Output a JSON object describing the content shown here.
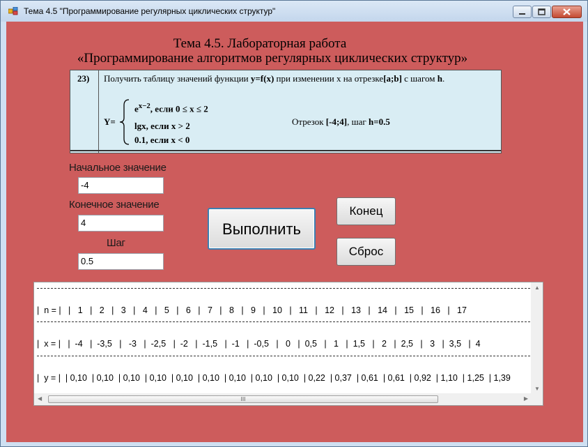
{
  "window": {
    "title": "Тема 4.5 \"Программирование регулярных циклических структур\""
  },
  "heading": {
    "line1": "Тема 4.5.  Лабораторная работа",
    "line2": "«Программирование алгоритмов регулярных циклических структур»"
  },
  "task": {
    "number": "23)",
    "description_part1": "Получить таблицу значений функции ",
    "description_fx": "y=f(x)",
    "description_part2": " при изменении x  на отрезке",
    "description_range": "[a;b]",
    "description_part3": " с шагом ",
    "description_step": "h",
    "description_end": ".",
    "y_label": "Y=",
    "case1_expr": "e",
    "case1_exp": "x−2",
    "case1_cond": ",    если 0 ≤ x ≤ 2",
    "case2": "lgx,     если x > 2",
    "case3": "0.1,      если x < 0",
    "segment_prefix": "Отрезок ",
    "segment_value": "[-4;4]",
    "segment_mid": ",  шаг ",
    "segment_step": "h=0.5"
  },
  "form": {
    "start_label": "Начальное значение",
    "start_value": "-4",
    "end_label": "Конечное значение",
    "end_value": "4",
    "step_label": "Шаг",
    "step_value": "0.5"
  },
  "buttons": {
    "run": "Выполнить",
    "exit": "Конец",
    "reset": "Сброс"
  },
  "output": {
    "n_row": "|  n = |   |   1   |   2   |   3   |   4   |   5   |   6   |   7   |   8   |   9   |   10   |   11   |   12   |   13   |   14   |   15   |   16   |   17",
    "x_row": "|  x = |   |  -4   |  -3,5   |   -3   |  -2,5   |  -2   |  -1,5   |  -1   |  -0,5   |   0   |  0,5   |   1   |  1,5   |   2   |  2,5   |   3   |  3,5   |  4",
    "y_row": "|  y = |  | 0,10  | 0,10  | 0,10  | 0,10  | 0,10  | 0,10  | 0,10  | 0,10  | 0,10  | 0,22  | 0,37  | 0,61  | 0,61  | 0,92  | 1,10  | 1,25  | 1,39",
    "scroll_thumb_label": "III"
  },
  "colors": {
    "form_background": "#cd5c5c",
    "task_background": "#d9edf4"
  }
}
